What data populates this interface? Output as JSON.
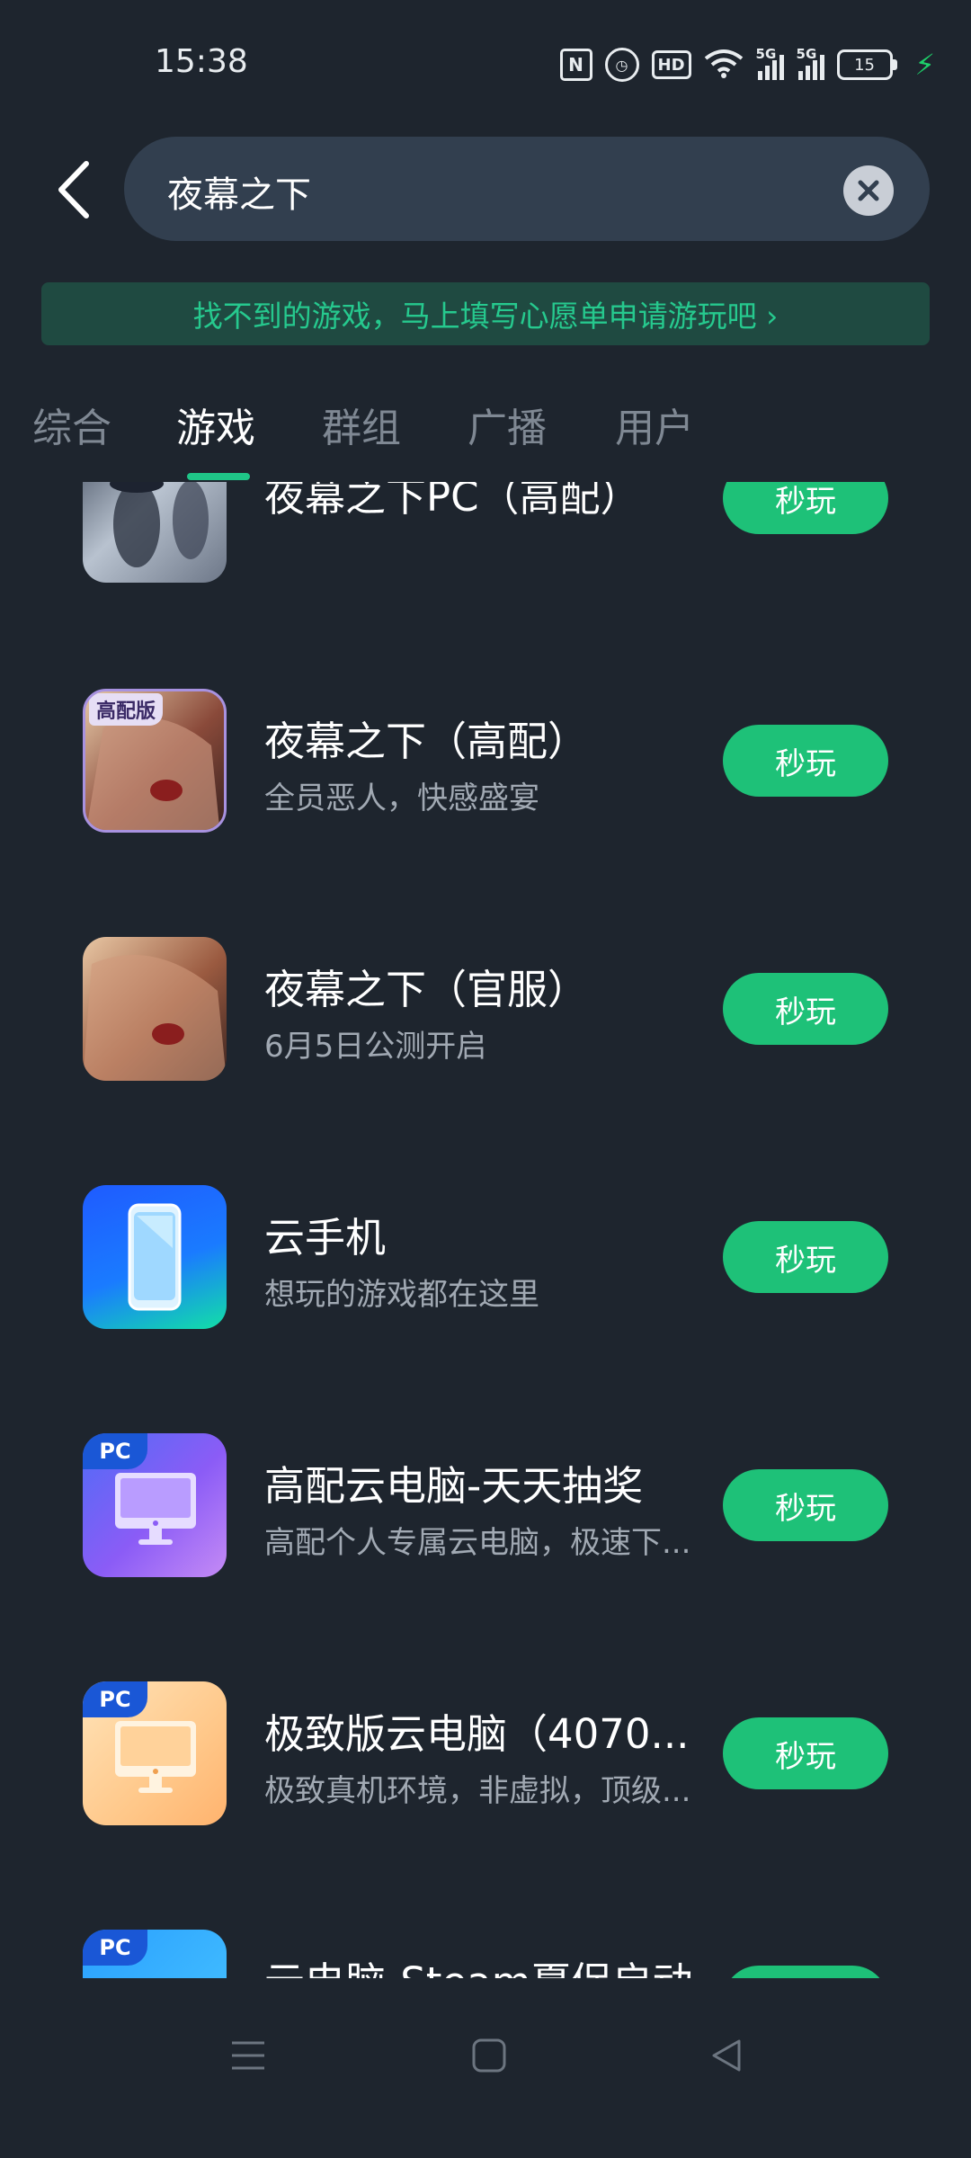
{
  "status_bar": {
    "time": "15:38",
    "hd_label": "HD",
    "network1": "5G",
    "network2": "5G",
    "battery_level": "15",
    "icons": [
      "nfc-icon",
      "alarm-icon",
      "hd-icon",
      "wifi-icon",
      "signal-icon",
      "signal-icon",
      "battery-icon",
      "charging-icon"
    ]
  },
  "search": {
    "query": "夜幕之下"
  },
  "banner": {
    "text": "找不到的游戏，马上填写心愿单申请游玩吧 ›"
  },
  "tabs": [
    {
      "label": "综合",
      "active": false
    },
    {
      "label": "游戏",
      "active": true
    },
    {
      "label": "群组",
      "active": false
    },
    {
      "label": "广播",
      "active": false
    },
    {
      "label": "用户",
      "active": false
    }
  ],
  "results": [
    {
      "title": "夜幕之下PC（高配）",
      "subtitle": "",
      "button": "秒玩"
    },
    {
      "title": "夜幕之下（高配）",
      "subtitle": "全员恶人，快感盛宴",
      "button": "秒玩",
      "badge": "高配版"
    },
    {
      "title": "夜幕之下（官服）",
      "subtitle": "6月5日公测开启",
      "button": "秒玩"
    },
    {
      "title": "云手机",
      "subtitle": "想玩的游戏都在这里",
      "button": "秒玩"
    },
    {
      "title": "高配云电脑-天天抽奖",
      "subtitle": "高配个人专属云电脑，极速下...",
      "button": "秒玩",
      "badge": "PC"
    },
    {
      "title": "极致版云电脑（4070...",
      "subtitle": "极致真机环境，非虚拟，顶级...",
      "button": "秒玩",
      "badge": "PC"
    },
    {
      "title": "云电脑-Steam夏促启动",
      "subtitle": "",
      "button": "秒玩",
      "badge": "PC"
    }
  ],
  "colors": {
    "background": "#1e252e",
    "accent_green": "#1ec178",
    "banner_bg": "#1f4a41",
    "search_bg": "#323f4f"
  }
}
